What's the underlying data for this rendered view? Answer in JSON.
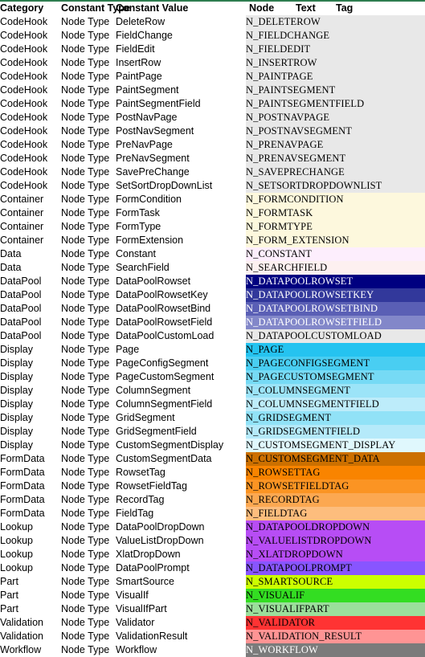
{
  "accent_line_color": "#2e7d4f",
  "headers": {
    "category": "Category",
    "constant_type": "Constant Type",
    "constant_value": "Constant Value",
    "node": "Node",
    "text": "Text",
    "tag": "Tag"
  },
  "chart_data": {
    "type": "table",
    "title": "",
    "columns": [
      "Category",
      "Constant Type",
      "Constant Value",
      "Node",
      "Text",
      "Tag"
    ],
    "note": "Node column cells are color-coded by Category group"
  },
  "rows": [
    {
      "category": "CodeHook",
      "constant_type": "Node Type",
      "constant_value": "DeleteRow",
      "node": "N_DELETEROW",
      "bg": "#e8e8e8",
      "fg": "#000000"
    },
    {
      "category": "CodeHook",
      "constant_type": "Node Type",
      "constant_value": "FieldChange",
      "node": "N_FIELDCHANGE",
      "bg": "#e8e8e8",
      "fg": "#000000"
    },
    {
      "category": "CodeHook",
      "constant_type": "Node Type",
      "constant_value": "FieldEdit",
      "node": "N_FIELDEDIT",
      "bg": "#e8e8e8",
      "fg": "#000000"
    },
    {
      "category": "CodeHook",
      "constant_type": "Node Type",
      "constant_value": "InsertRow",
      "node": "N_INSERTROW",
      "bg": "#e8e8e8",
      "fg": "#000000"
    },
    {
      "category": "CodeHook",
      "constant_type": "Node Type",
      "constant_value": "PaintPage",
      "node": "N_PAINTPAGE",
      "bg": "#e8e8e8",
      "fg": "#000000"
    },
    {
      "category": "CodeHook",
      "constant_type": "Node Type",
      "constant_value": "PaintSegment",
      "node": "N_PAINTSEGMENT",
      "bg": "#e8e8e8",
      "fg": "#000000"
    },
    {
      "category": "CodeHook",
      "constant_type": "Node Type",
      "constant_value": "PaintSegmentField",
      "node": "N_PAINTSEGMENTFIELD",
      "bg": "#e8e8e8",
      "fg": "#000000"
    },
    {
      "category": "CodeHook",
      "constant_type": "Node Type",
      "constant_value": "PostNavPage",
      "node": "N_POSTNAVPAGE",
      "bg": "#e8e8e8",
      "fg": "#000000"
    },
    {
      "category": "CodeHook",
      "constant_type": "Node Type",
      "constant_value": "PostNavSegment",
      "node": "N_POSTNAVSEGMENT",
      "bg": "#e8e8e8",
      "fg": "#000000"
    },
    {
      "category": "CodeHook",
      "constant_type": "Node Type",
      "constant_value": "PreNavPage",
      "node": "N_PRENAVPAGE",
      "bg": "#e8e8e8",
      "fg": "#000000"
    },
    {
      "category": "CodeHook",
      "constant_type": "Node Type",
      "constant_value": "PreNavSegment",
      "node": "N_PRENAVSEGMENT",
      "bg": "#e8e8e8",
      "fg": "#000000"
    },
    {
      "category": "CodeHook",
      "constant_type": "Node Type",
      "constant_value": "SavePreChange",
      "node": "N_SAVEPRECHANGE",
      "bg": "#e8e8e8",
      "fg": "#000000"
    },
    {
      "category": "CodeHook",
      "constant_type": "Node Type",
      "constant_value": "SetSortDropDownList",
      "node": "N_SETSORTDROPDOWNLIST",
      "bg": "#e8e8e8",
      "fg": "#000000"
    },
    {
      "category": "Container",
      "constant_type": "Node Type",
      "constant_value": "FormCondition",
      "node": "N_FORMCONDITION",
      "bg": "#fdf8dd",
      "fg": "#000000"
    },
    {
      "category": "Container",
      "constant_type": "Node Type",
      "constant_value": "FormTask",
      "node": "N_FORMTASK",
      "bg": "#fdf8dd",
      "fg": "#000000"
    },
    {
      "category": "Container",
      "constant_type": "Node Type",
      "constant_value": "FormType",
      "node": "N_FORMTYPE",
      "bg": "#fdf8dd",
      "fg": "#000000"
    },
    {
      "category": "Container",
      "constant_type": "Node Type",
      "constant_value": "FormExtension",
      "node": "N_FORM_EXTENSION",
      "bg": "#fdf8dd",
      "fg": "#000000"
    },
    {
      "category": "Data",
      "constant_type": "Node Type",
      "constant_value": "Constant",
      "node": "N_CONSTANT",
      "bg": "#fdeefd",
      "fg": "#000000"
    },
    {
      "category": "Data",
      "constant_type": "Node Type",
      "constant_value": "SearchField",
      "node": "N_SEARCHFIELD",
      "bg": "#fdf0f0",
      "fg": "#000000"
    },
    {
      "category": "DataPool",
      "constant_type": "Node Type",
      "constant_value": "DataPoolRowset",
      "node": "N_DATAPOOLROWSET",
      "bg": "#000080",
      "fg": "#ffffff"
    },
    {
      "category": "DataPool",
      "constant_type": "Node Type",
      "constant_value": "DataPoolRowsetKey",
      "node": "N_DATAPOOLROWSETKEY",
      "bg": "#32389b",
      "fg": "#ffffff"
    },
    {
      "category": "DataPool",
      "constant_type": "Node Type",
      "constant_value": "DataPoolRowsetBind",
      "node": "N_DATAPOOLROWSETBIND",
      "bg": "#5a5fb5",
      "fg": "#ffffff"
    },
    {
      "category": "DataPool",
      "constant_type": "Node Type",
      "constant_value": "DataPoolRowsetField",
      "node": "N_DATAPOOLROWSETFIELD",
      "bg": "#8287c9",
      "fg": "#ffffff"
    },
    {
      "category": "DataPool",
      "constant_type": "Node Type",
      "constant_value": "DataPoolCustomLoad",
      "node": "N_DATAPOOLCUSTOMLOAD",
      "bg": "#e8e8e8",
      "fg": "#000000"
    },
    {
      "category": "Display",
      "constant_type": "Node Type",
      "constant_value": "Page",
      "node": "N_PAGE",
      "bg": "#25c3f0",
      "fg": "#000000"
    },
    {
      "category": "Display",
      "constant_type": "Node Type",
      "constant_value": "PageConfigSegment",
      "node": "N_PAGECONFIGSEGMENT",
      "bg": "#49cef2",
      "fg": "#000000"
    },
    {
      "category": "Display",
      "constant_type": "Node Type",
      "constant_value": "PageCustomSegment",
      "node": "N_PAGECUSTOMSEGMENT",
      "bg": "#76daf5",
      "fg": "#000000"
    },
    {
      "category": "Display",
      "constant_type": "Node Type",
      "constant_value": "ColumnSegment",
      "node": "N_COLUMNSEGMENT",
      "bg": "#9ce4f8",
      "fg": "#000000"
    },
    {
      "category": "Display",
      "constant_type": "Node Type",
      "constant_value": "ColumnSegmentField",
      "node": "N_COLUMNSEGMENTFIELD",
      "bg": "#bdecfa",
      "fg": "#000000"
    },
    {
      "category": "Display",
      "constant_type": "Node Type",
      "constant_value": "GridSegment",
      "node": "N_GRIDSEGMENT",
      "bg": "#91e2f7",
      "fg": "#000000"
    },
    {
      "category": "Display",
      "constant_type": "Node Type",
      "constant_value": "GridSegmentField",
      "node": "N_GRIDSEGMENTFIELD",
      "bg": "#b5eafa",
      "fg": "#000000"
    },
    {
      "category": "Display",
      "constant_type": "Node Type",
      "constant_value": "CustomSegmentDisplay",
      "node": "N_CUSTOMSEGMENT_DISPLAY",
      "bg": "#e0f8fd",
      "fg": "#000000"
    },
    {
      "category": "FormData",
      "constant_type": "Node Type",
      "constant_value": "CustomSegmentData",
      "node": "N_CUSTOMSEGMENT_DATA",
      "bg": "#cc7000",
      "fg": "#000000"
    },
    {
      "category": "FormData",
      "constant_type": "Node Type",
      "constant_value": "RowsetTag",
      "node": "N_ROWSETTAG",
      "bg": "#f98400",
      "fg": "#000000"
    },
    {
      "category": "FormData",
      "constant_type": "Node Type",
      "constant_value": "RowsetFieldTag",
      "node": "N_ROWSETFIELDTAG",
      "bg": "#fb9423",
      "fg": "#000000"
    },
    {
      "category": "FormData",
      "constant_type": "Node Type",
      "constant_value": "RecordTag",
      "node": "N_RECORDTAG",
      "bg": "#fca851",
      "fg": "#000000"
    },
    {
      "category": "FormData",
      "constant_type": "Node Type",
      "constant_value": "FieldTag",
      "node": "N_FIELDTAG",
      "bg": "#fdbd7d",
      "fg": "#000000"
    },
    {
      "category": "Lookup",
      "constant_type": "Node Type",
      "constant_value": "DataPoolDropDown",
      "node": "N_DATAPOOLDROPDOWN",
      "bg": "#b74df5",
      "fg": "#000000"
    },
    {
      "category": "Lookup",
      "constant_type": "Node Type",
      "constant_value": "ValueListDropDown",
      "node": "N_VALUELISTDROPDOWN",
      "bg": "#b74df5",
      "fg": "#000000"
    },
    {
      "category": "Lookup",
      "constant_type": "Node Type",
      "constant_value": "XlatDropDown",
      "node": "N_XLATDROPDOWN",
      "bg": "#b74df5",
      "fg": "#000000"
    },
    {
      "category": "Lookup",
      "constant_type": "Node Type",
      "constant_value": "DataPoolPrompt",
      "node": "N_DATAPOOLPROMPT",
      "bg": "#8855ff",
      "fg": "#000000"
    },
    {
      "category": "Part",
      "constant_type": "Node Type",
      "constant_value": "SmartSource",
      "node": "N_SMARTSOURCE",
      "bg": "#ccff00",
      "fg": "#000000"
    },
    {
      "category": "Part",
      "constant_type": "Node Type",
      "constant_value": "VisualIf",
      "node": "N_VISUALIF",
      "bg": "#33dd22",
      "fg": "#000000"
    },
    {
      "category": "Part",
      "constant_type": "Node Type",
      "constant_value": "VisualIfPart",
      "node": "N_VISUALIFPART",
      "bg": "#9bdf9b",
      "fg": "#000000"
    },
    {
      "category": "Validation",
      "constant_type": "Node Type",
      "constant_value": "Validator",
      "node": "N_VALIDATOR",
      "bg": "#ff3333",
      "fg": "#000000"
    },
    {
      "category": "Validation",
      "constant_type": "Node Type",
      "constant_value": "ValidationResult",
      "node": "N_VALIDATION_RESULT",
      "bg": "#ff9494",
      "fg": "#000000"
    },
    {
      "category": "Workflow",
      "constant_type": "Node Type",
      "constant_value": "Workflow",
      "node": "N_WORKFLOW",
      "bg": "#7b7b7b",
      "fg": "#ffffff"
    }
  ]
}
